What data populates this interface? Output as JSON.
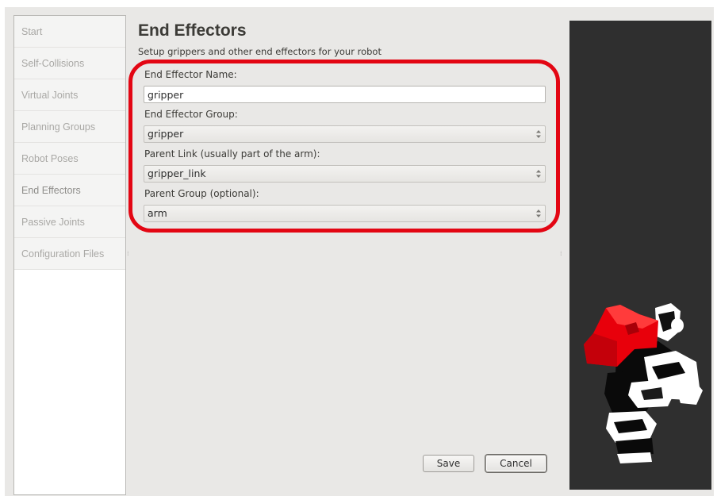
{
  "sidebar": {
    "items": [
      {
        "label": "Start"
      },
      {
        "label": "Self-Collisions"
      },
      {
        "label": "Virtual Joints"
      },
      {
        "label": "Planning Groups"
      },
      {
        "label": "Robot Poses"
      },
      {
        "label": "End Effectors"
      },
      {
        "label": "Passive Joints"
      },
      {
        "label": "Configuration Files"
      }
    ],
    "active": "End Effectors"
  },
  "page": {
    "title": "End Effectors",
    "subtitle": "Setup grippers and other end effectors for your robot"
  },
  "form": {
    "name_label": "End Effector Name:",
    "name_value": "gripper",
    "group_label": "End Effector Group:",
    "group_value": "gripper",
    "parent_link_label": "Parent Link (usually part of the arm):",
    "parent_link_value": "gripper_link",
    "parent_group_label": "Parent Group (optional):",
    "parent_group_value": "arm"
  },
  "buttons": {
    "save": "Save",
    "cancel": "Cancel"
  },
  "colors": {
    "highlight": "#e30613",
    "viewport_bg": "#2f2f2f",
    "robot_highlight": "#e8000b"
  }
}
